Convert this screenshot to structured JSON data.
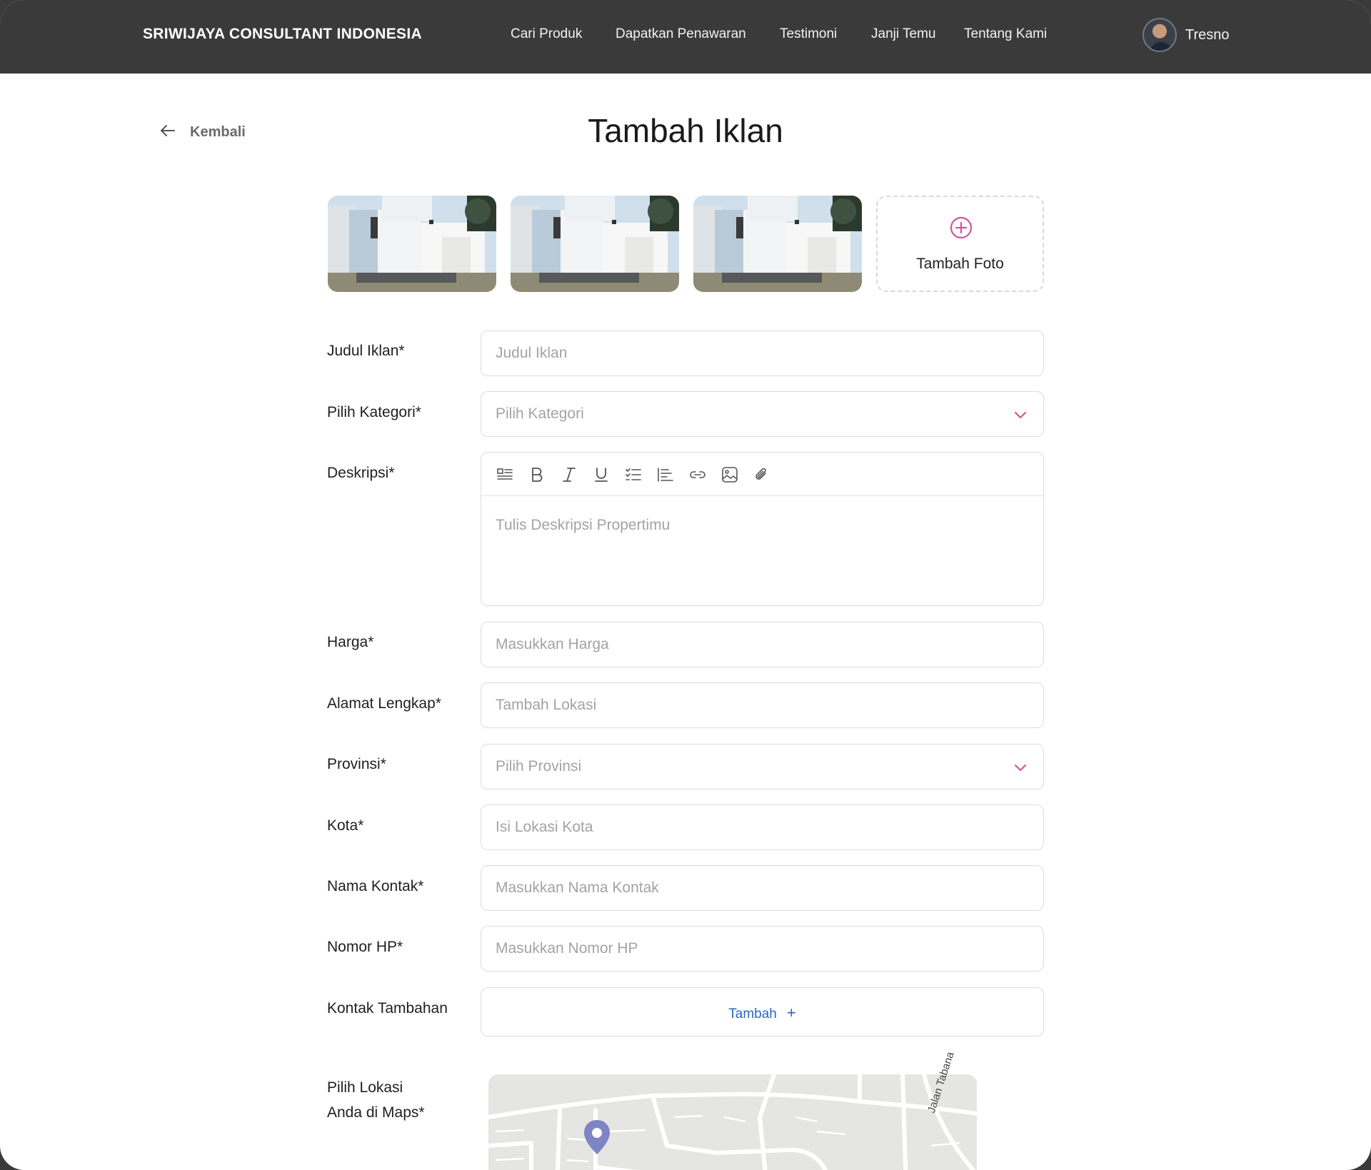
{
  "navbar": {
    "brand": "SRIWIJAYA CONSULTANT INDONESIA",
    "links": [
      "Cari Produk",
      "Dapatkan Penawaran",
      "Testimoni",
      "Janji Temu",
      "Tentang Kami"
    ],
    "user_name": "Tresno"
  },
  "back_label": "Kembali",
  "page_title": "Tambah Iklan",
  "photos": {
    "add_label": "Tambah Foto"
  },
  "form": {
    "title": {
      "label": "Judul Iklan*",
      "placeholder": "Judul Iklan"
    },
    "category": {
      "label": "Pilih Kategori*",
      "placeholder": "Pilih Kategori"
    },
    "description": {
      "label": "Deskripsi*",
      "placeholder": "Tulis Deskripsi Propertimu"
    },
    "price": {
      "label": "Harga*",
      "placeholder": "Masukkan Harga"
    },
    "address": {
      "label": "Alamat Lengkap*",
      "placeholder": "Tambah Lokasi"
    },
    "province": {
      "label": "Provinsi*",
      "placeholder": "Pilih Provinsi"
    },
    "city": {
      "label": "Kota*",
      "placeholder": "Isi Lokasi Kota"
    },
    "contact_name": {
      "label": "Nama Kontak*",
      "placeholder": "Masukkan Nama Kontak"
    },
    "phone": {
      "label": "Nomor HP*",
      "placeholder": "Masukkan Nomor HP"
    },
    "extra_contact": {
      "label": "Kontak Tambahan",
      "button": "Tambah",
      "button_icon": "+"
    },
    "maps": {
      "label_line1": "Pilih Lokasi",
      "label_line2": "Anda di Maps*",
      "road_name": "Jalan Tabana"
    }
  },
  "toolbar_icons": [
    "paragraph-icon",
    "bold-icon",
    "italic-icon",
    "underline-icon",
    "checklist-icon",
    "align-left-icon",
    "link-icon",
    "image-icon",
    "attachment-icon"
  ],
  "colors": {
    "navbar_bg": "#3a3a3a",
    "accent_pink": "#d2559a",
    "link_blue": "#2a66c9",
    "map_pin": "#7f84c4"
  }
}
